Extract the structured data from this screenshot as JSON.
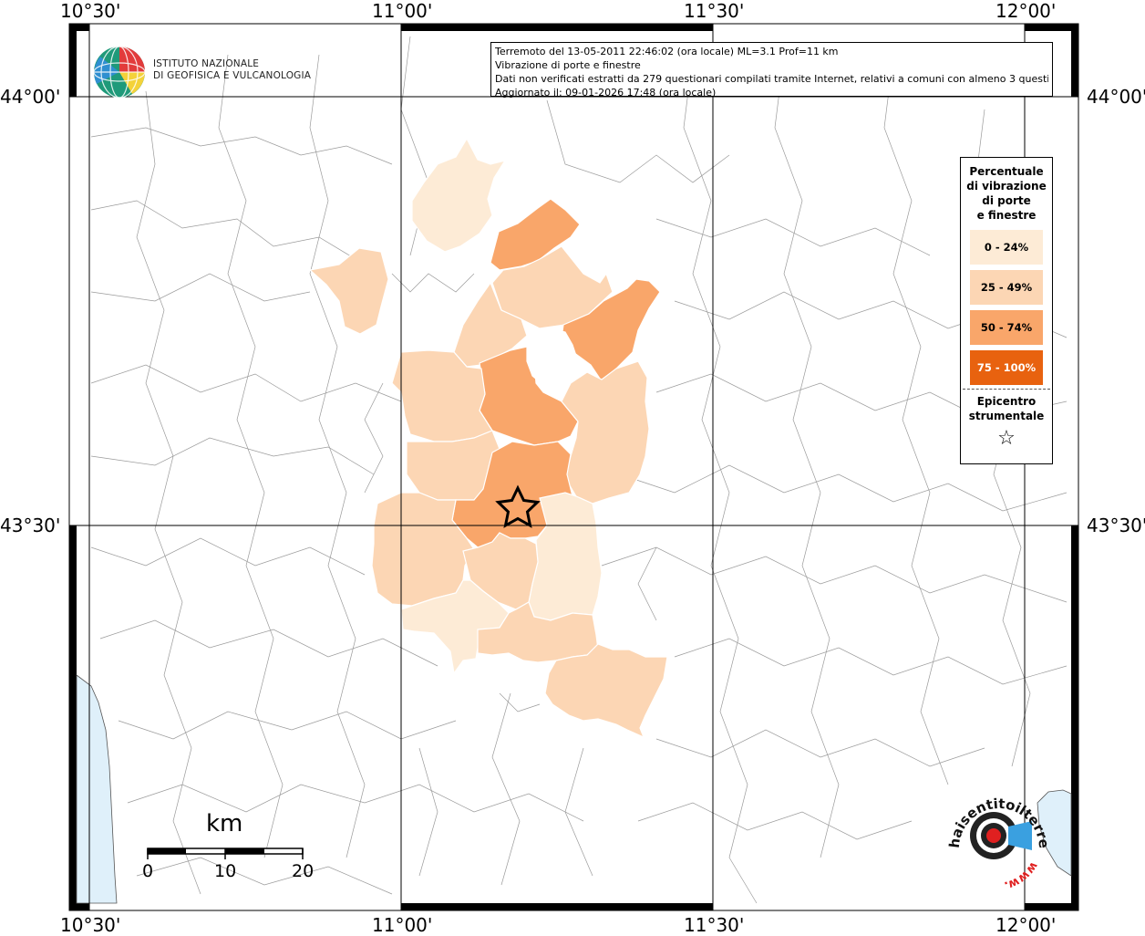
{
  "map": {
    "x_ticks": [
      "10°30'",
      "11°00'",
      "11°30'",
      "12°00'"
    ],
    "y_ticks": [
      "44°00'",
      "43°30'"
    ]
  },
  "info": {
    "line1": "Terremoto del 13-05-2011 22:46:02 (ora locale) ML=3.1 Prof=11 km",
    "line2": "Vibrazione di porte e finestre",
    "line3": "Dati non verificati estratti da 279 questionari compilati tramite Internet, relativi a comuni con almeno 3 questionari.",
    "line4": "Aggiornato il: 09-01-2026 17:48 (ora locale)"
  },
  "logo": {
    "line1": "ISTITUTO NAZIONALE",
    "line2": "DI GEOFISICA E VULCANOLOGIA"
  },
  "legend": {
    "title": [
      "Percentuale",
      "di vibrazione",
      "di porte",
      "e finestre"
    ],
    "classes": [
      {
        "label": "0 - 24%",
        "color": "#fdebd6"
      },
      {
        "label": "25 - 49%",
        "color": "#fcd6b4"
      },
      {
        "label": "50 - 74%",
        "color": "#f9a66a"
      },
      {
        "label": "75 - 100%",
        "color": "#e8620f"
      }
    ],
    "epicenter_title": [
      "Epicentro",
      "strumentale"
    ],
    "epicenter_symbol": "☆"
  },
  "scale": {
    "unit": "km",
    "labels": [
      "0",
      "10",
      "20"
    ]
  },
  "watermark": {
    "text": "haisentitoilterremoto.it",
    "prefix": "www."
  },
  "colors": {
    "border": "#808080",
    "sea": "#dff0fa",
    "grid": "#000000",
    "epicenter": "#000000"
  }
}
